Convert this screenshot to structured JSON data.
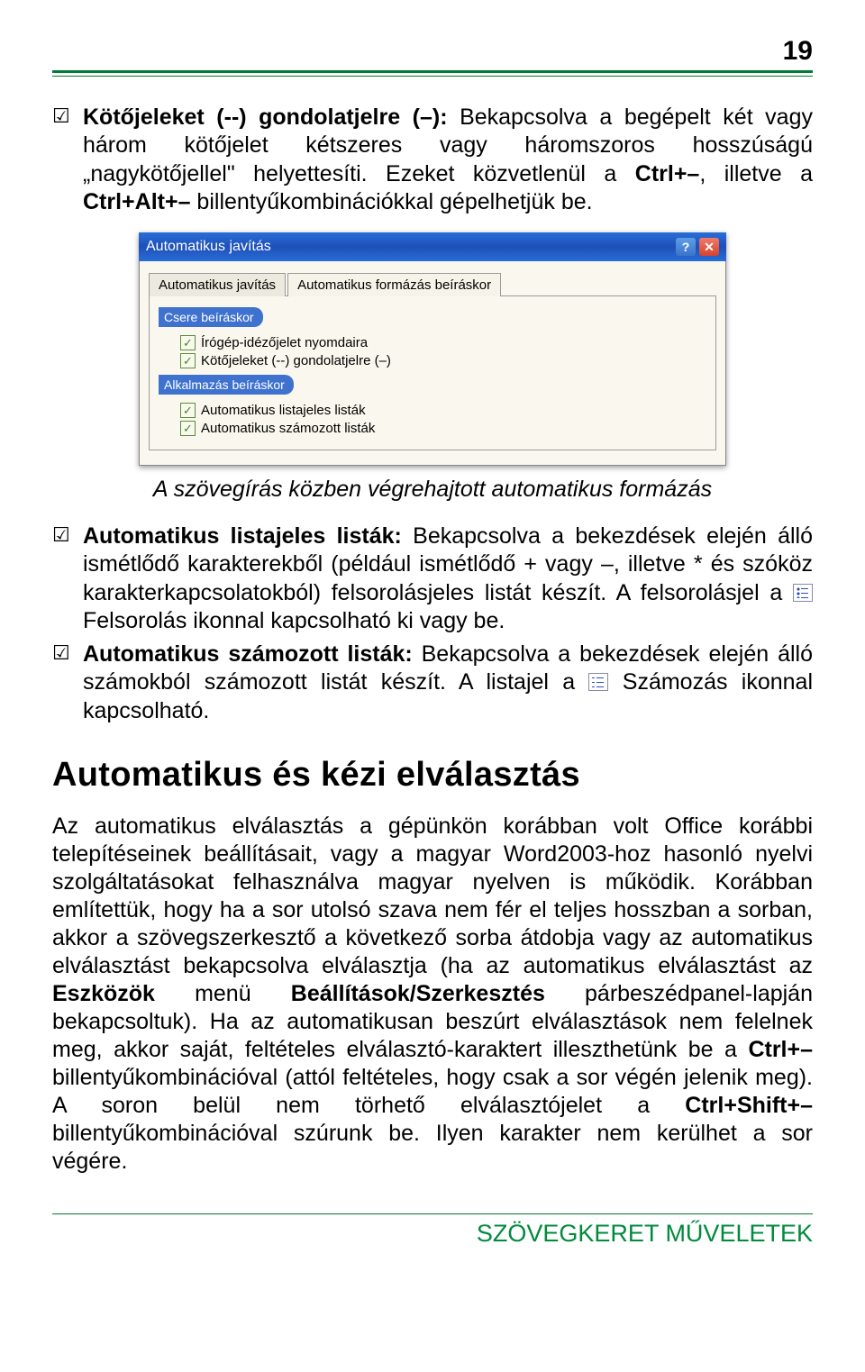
{
  "page_number": "19",
  "para1": {
    "lead": "Kötőjeleket (--) gondolatjelre (–):",
    "text_a": " Bekapcsolva a begépelt két vagy három kötőjelet kétszeres vagy háromszoros hosszúságú „nagykötőjellel\" helyettesíti. Ezeket közvetlenül a ",
    "cmd1": "Ctrl+–",
    "text_b": ", illetve a ",
    "cmd2": "Ctrl+Alt+–",
    "text_c": " billentyűkombinációkkal gépelhetjük be."
  },
  "dialog": {
    "title": "Automatikus javítás",
    "tab_inactive": "Automatikus javítás",
    "tab_active": "Automatikus formázás beíráskor",
    "section1": "Csere beíráskor",
    "cb1": "Írógép-idézőjelet nyomdaira",
    "cb2": "Kötőjeleket (--) gondolatjelre (–)",
    "section2": "Alkalmazás beíráskor",
    "cb3": "Automatikus listajeles listák",
    "cb4": "Automatikus számozott listák"
  },
  "caption": "A szövegírás közben végrehajtott automatikus formázás",
  "para2": {
    "lead": "Automatikus listajeles listák:",
    "text_a": " Bekapcsolva a bekezdések elején álló ismétlődő karakterekből (például ismétlődő + vagy –, illetve * és szóköz karakterkapcsolatokból) felsorolásjeles listát készít. A felsorolásjel a ",
    "text_b": " Felsorolás ikonnal kapcsolható ki vagy be."
  },
  "para3": {
    "lead": "Automatikus számozott listák:",
    "text_a": " Bekapcsolva a bekezdések elején álló számokból számozott listát készít. A listajel a ",
    "text_b": " Számozás ikonnal kapcsolható."
  },
  "heading": "Automatikus és kézi elválasztás",
  "para4": {
    "a": "Az automatikus elválasztás a gépünkön korábban volt Office korábbi telepítéseinek beállításait, vagy a magyar Word2003-hoz hasonló nyelvi szolgáltatásokat felhasználva magyar nyelven is működik. Korábban említettük, hogy ha a sor utolsó szava nem fér el teljes hosszban a sorban, akkor a szövegszerkesztő a következő sorba átdobja vagy az automatikus elválasztást bekapcsolva elválasztja (ha az automatikus elválasztást az ",
    "b_bold": "Eszközök",
    "c": " menü ",
    "d_bold": "Beállítások/Szerkesztés",
    "e": " párbeszédpanel-lapján bekapcsoltuk). Ha az automatikusan beszúrt elválasztások nem felelnek meg, akkor saját, feltételes elválasztó-karaktert illeszthetünk be a ",
    "f_bold": "Ctrl+–",
    "g": " billentyűkombinációval (attól feltételes, hogy csak a sor végén jelenik meg). A soron belül nem törhető elválasztójelet a ",
    "h_bold": "Ctrl+Shift+–",
    "i": " billentyűkombinációval szúrunk be. Ilyen karakter nem kerülhet a sor végére."
  },
  "footer": "SZÖVEGKERET MŰVELETEK"
}
